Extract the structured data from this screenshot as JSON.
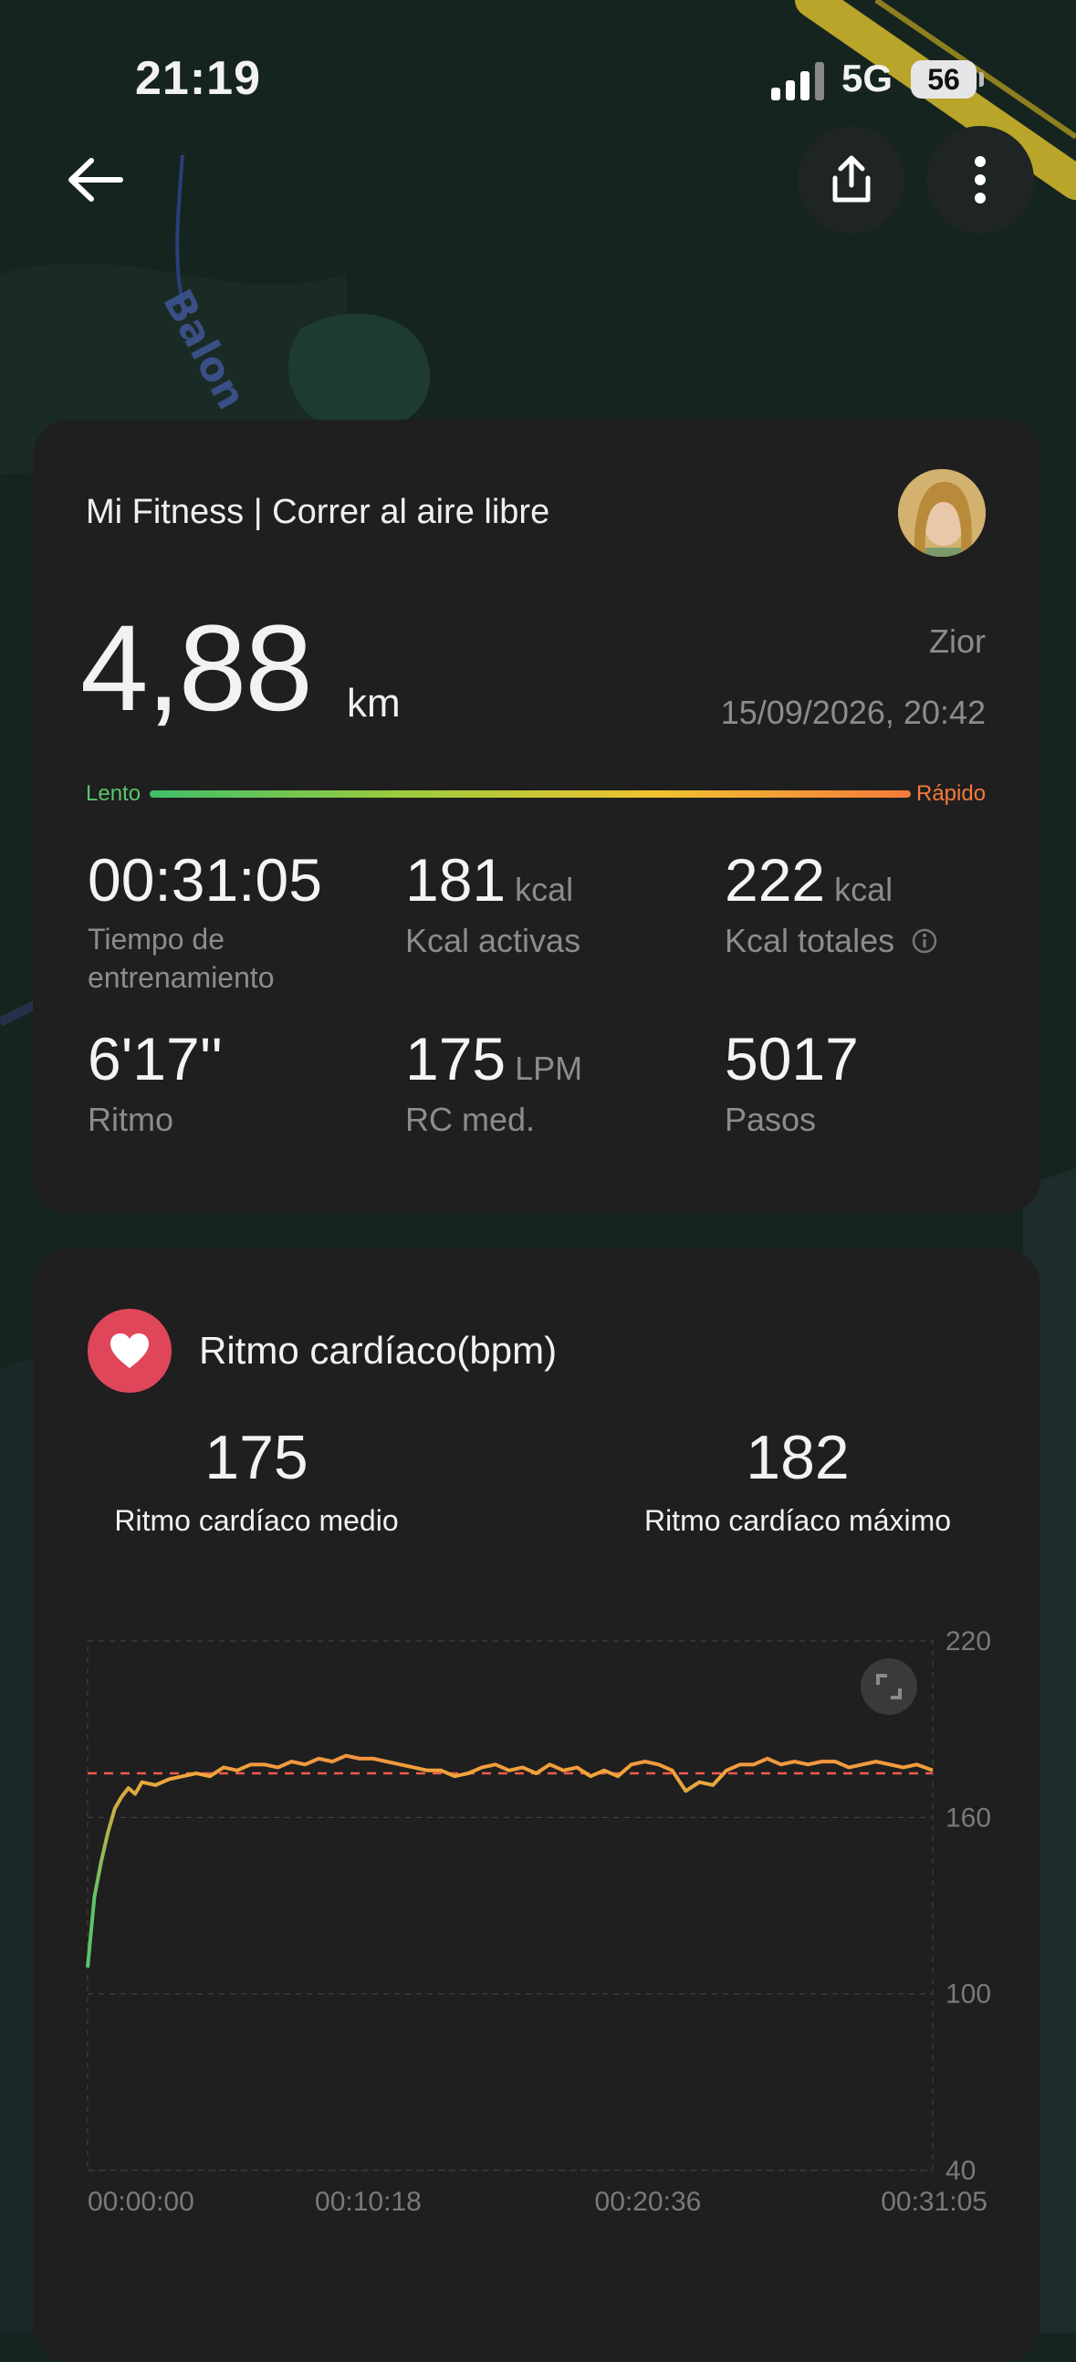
{
  "status_bar": {
    "time": "21:19",
    "network": "5G",
    "battery": "56"
  },
  "workout": {
    "source": "Mi Fitness | Correr al aire libre",
    "distance": "4,88",
    "distance_unit": "km",
    "user": "Zior",
    "datetime": "15/09/2026, 20:42",
    "pace_slow": "Lento",
    "pace_fast": "Rápido",
    "stats": [
      {
        "value": "00:31:05",
        "unit": "",
        "label": "Tiempo de entrenamiento"
      },
      {
        "value": "181",
        "unit": "kcal",
        "label": "Kcal activas"
      },
      {
        "value": "222",
        "unit": "kcal",
        "label": "Kcal totales"
      },
      {
        "value": "6'17''",
        "unit": "",
        "label": "Ritmo"
      },
      {
        "value": "175",
        "unit": "LPM",
        "label": "RC med."
      },
      {
        "value": "5017",
        "unit": "",
        "label": "Pasos"
      }
    ]
  },
  "map": {
    "street_label": "Balon"
  },
  "heart_rate": {
    "title": "Ritmo cardíaco(bpm)",
    "avg_value": "175",
    "avg_label": "Ritmo cardíaco medio",
    "max_value": "182",
    "max_label": "Ritmo cardíaco máximo"
  },
  "chart_data": {
    "type": "line",
    "title": "Ritmo cardíaco(bpm)",
    "x_ticks": [
      "00:00:00",
      "00:10:18",
      "00:20:36",
      "00:31:05"
    ],
    "y_ticks": [
      220,
      160,
      100,
      40
    ],
    "ylim": [
      40,
      220
    ],
    "xlim_seconds": [
      0,
      1865
    ],
    "grid": true,
    "average_line": 175,
    "series": [
      {
        "x_seconds": [
          0,
          15,
          30,
          45,
          60,
          75,
          90,
          105,
          120,
          150,
          180,
          210,
          240,
          270,
          300,
          330,
          360,
          390,
          420,
          450,
          480,
          510,
          540,
          570,
          600,
          630,
          660,
          690,
          720,
          750,
          780,
          810,
          840,
          870,
          900,
          930,
          960,
          990,
          1020,
          1050,
          1080,
          1110,
          1140,
          1170,
          1200,
          1230,
          1260,
          1290,
          1320,
          1350,
          1380,
          1410,
          1440,
          1470,
          1500,
          1530,
          1560,
          1590,
          1620,
          1650,
          1680,
          1710,
          1740,
          1770,
          1800,
          1830,
          1865
        ],
        "values": [
          109,
          133,
          145,
          155,
          163,
          167,
          170,
          168,
          172,
          171,
          173,
          174,
          175,
          174,
          177,
          176,
          178,
          178,
          177,
          179,
          178,
          180,
          179,
          181,
          180,
          180,
          179,
          178,
          177,
          176,
          176,
          174,
          175,
          177,
          178,
          176,
          177,
          175,
          178,
          176,
          177,
          174,
          176,
          174,
          178,
          179,
          178,
          176,
          169,
          172,
          171,
          176,
          178,
          178,
          180,
          178,
          179,
          178,
          179,
          179,
          177,
          178,
          179,
          178,
          177,
          178,
          176
        ]
      }
    ]
  }
}
